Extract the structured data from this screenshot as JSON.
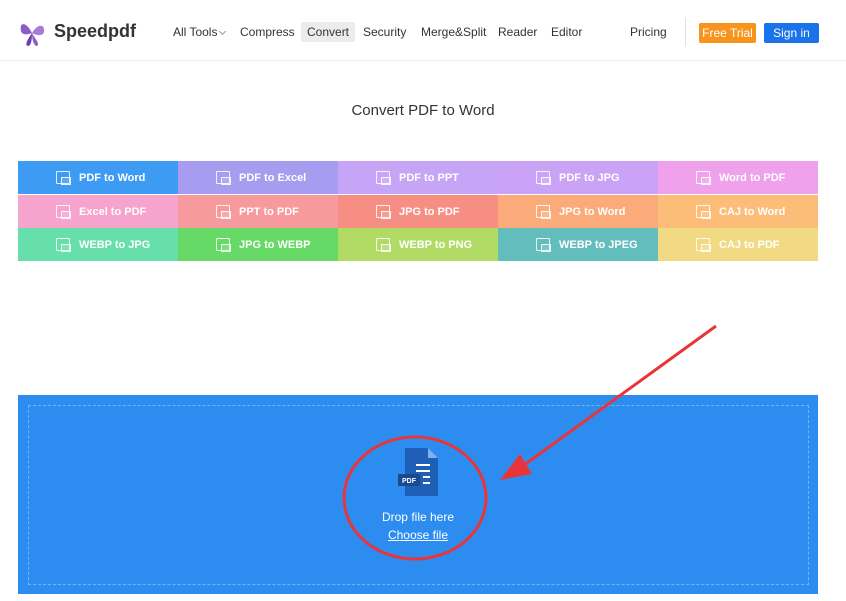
{
  "header": {
    "brand": "Speedpdf",
    "nav": [
      "All Tools",
      "Compress",
      "Convert",
      "Security",
      "Merge&Split",
      "Reader",
      "Editor"
    ],
    "pricing": "Pricing",
    "free_trial": "Free Trial",
    "sign_in": "Sign in"
  },
  "main": {
    "title": "Convert PDF to Word",
    "tools": [
      {
        "label": "PDF to Word",
        "color": "#3e9bf4"
      },
      {
        "label": "PDF to Excel",
        "color": "#a79cf0"
      },
      {
        "label": "PDF to PPT",
        "color": "#c6a4f6"
      },
      {
        "label": "PDF to JPG",
        "color": "#caa2f6"
      },
      {
        "label": "Word to PDF",
        "color": "#f0a1ec"
      },
      {
        "label": "Excel to PDF",
        "color": "#f6a3cd"
      },
      {
        "label": "PPT to PDF",
        "color": "#f79a9e"
      },
      {
        "label": "JPG to PDF",
        "color": "#f78e83"
      },
      {
        "label": "JPG to Word",
        "color": "#fbab7a"
      },
      {
        "label": "CAJ to Word",
        "color": "#fcbd79"
      },
      {
        "label": "WEBP to JPG",
        "color": "#66dfab"
      },
      {
        "label": "JPG to WEBP",
        "color": "#66d966"
      },
      {
        "label": "WEBP to PNG",
        "color": "#b2db66"
      },
      {
        "label": "WEBP to JPEG",
        "color": "#64bdbd"
      },
      {
        "label": "CAJ to PDF",
        "color": "#f1da83"
      }
    ],
    "dropzone": {
      "file_badge": "PDF",
      "drop_text": "Drop file here",
      "choose_file": "Choose file"
    }
  },
  "colors": {
    "accent_orange": "#f7941d",
    "accent_blue": "#1a73e8",
    "drop_blue": "#2d8cf0",
    "annotation_red": "#e8353a"
  }
}
